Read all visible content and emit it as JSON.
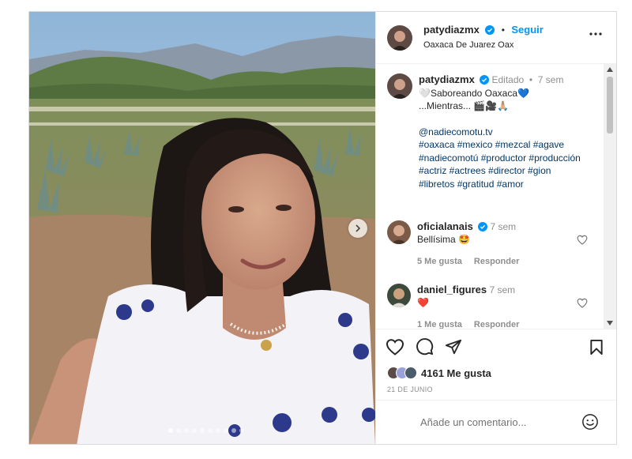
{
  "post": {
    "username": "patydiazmx",
    "follow_label": "Seguir",
    "separator": "•",
    "location": "Oaxaca De Juarez Oax",
    "more_icon": "more-horizontal-icon"
  },
  "caption": {
    "username": "patydiazmx",
    "edited": "Editado",
    "time": "7 sem",
    "line1": "🤍Saboreando Oaxaca💙",
    "line2": "...Mientras... 🎬🎥🙏🏼",
    "mention": "@nadiecomotu.tv",
    "hashtags_1": "#oaxaca #mexico #mezcal #agave",
    "hashtags_2": "#nadiecomotú #productor #producción",
    "hashtags_3": "#actriz #actrees #director #gion",
    "hashtags_4": "#libretos #gratitud #amor"
  },
  "comments": [
    {
      "username": "oficialanais",
      "verified": true,
      "time": "7 sem",
      "text": "Bellísima 🤩",
      "likes": "5 Me gusta",
      "reply": "Responder"
    },
    {
      "username": "daniel_figures",
      "verified": false,
      "time": "7 sem",
      "text": "❤️",
      "likes": "1 Me gusta",
      "reply": "Responder"
    }
  ],
  "actions": {
    "like_icon": "heart-icon",
    "comment_icon": "comment-icon",
    "share_icon": "paper-plane-icon",
    "save_icon": "bookmark-icon"
  },
  "likes_text": "4161 Me gusta",
  "date": "21 DE JUNIO",
  "add_comment": {
    "placeholder": "Añade un comentario..."
  },
  "carousel": {
    "count": 10,
    "active": 1
  },
  "colors": {
    "accent": "#0095f6",
    "verified": "#0095f6",
    "muted": "#8e8e8e",
    "hashtag": "#00376b"
  }
}
